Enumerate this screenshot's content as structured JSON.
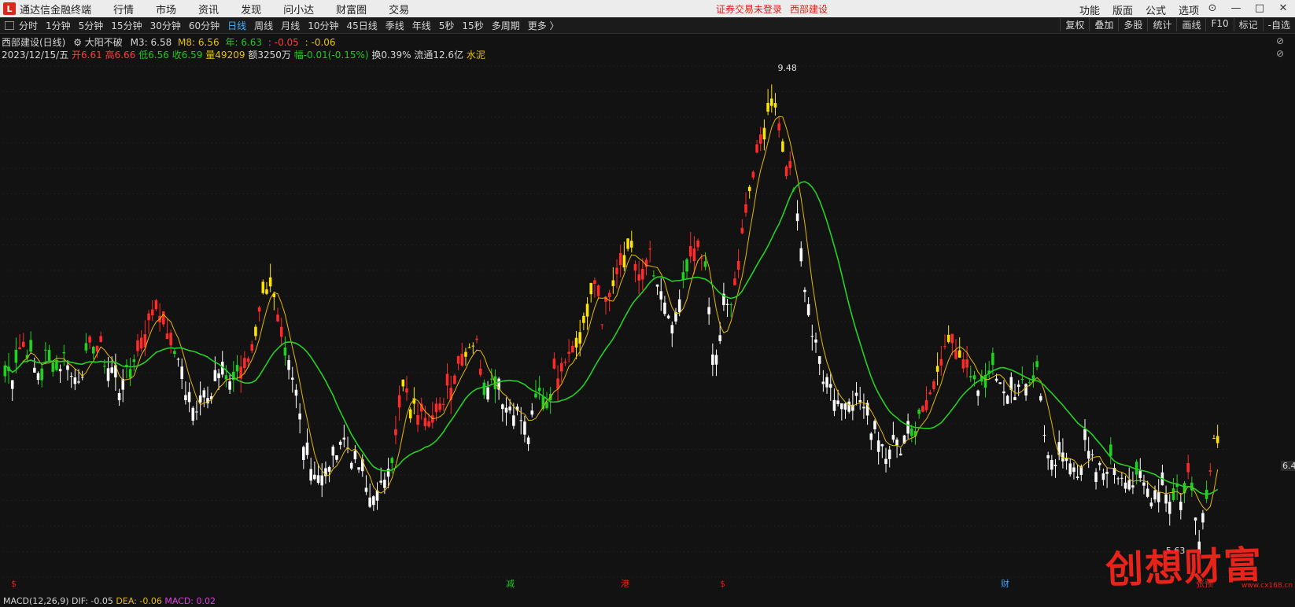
{
  "app": {
    "name": "通达信金融终端",
    "logo_glyph": "L",
    "menu": [
      "行情",
      "市场",
      "资讯",
      "发现",
      "问小达",
      "财富圈",
      "交易"
    ],
    "notice": "证券交易未登录",
    "stock_name": "西部建设",
    "right_menu": [
      "功能",
      "版面",
      "公式",
      "选项"
    ]
  },
  "toolbar": {
    "periods": [
      "分时",
      "1分钟",
      "5分钟",
      "15分钟",
      "30分钟",
      "60分钟",
      "日线",
      "周线",
      "月线",
      "10分钟",
      "45日线",
      "季线",
      "年线",
      "5秒",
      "15秒",
      "多周期",
      "更多 〉"
    ],
    "active_period": "日线",
    "right_tools": [
      "复权",
      "叠加",
      "多股",
      "统计",
      "画线",
      "F10",
      "标记",
      "-自选"
    ]
  },
  "info": {
    "title": "西部建设(日线)",
    "indicator_name": "大阳不破",
    "m3_label": "M3:",
    "m3": "6.58",
    "m8_label": "M8:",
    "m8": "6.56",
    "year_label": "年:",
    "year": "6.63",
    "sep1": ":",
    "v1": "-0.05",
    "sep2": ":",
    "v2": "-0.06",
    "date": "2023/12/15/五",
    "open": "开6.61",
    "high": "高6.66",
    "low": "低6.56",
    "close": "收6.59",
    "volume": "量49209",
    "amount": "额3250万",
    "change": "幅-0.01(-0.15%)",
    "turnover": "换0.39%",
    "float": "流通12.6亿",
    "sector": "水泥",
    "corner1": "⊘",
    "corner2": "⊘"
  },
  "chart_data": {
    "type": "candlestick",
    "max_label": "9.48",
    "min_label": "5.63",
    "last_price_label": "6.4",
    "ylim": [
      5.5,
      9.6
    ],
    "series_colors": {
      "up": "#ff2a2a",
      "down": "#ffffff",
      "strong": "#ffe400",
      "green_phase": "#1fd31f",
      "ma_short": "#e6b800",
      "ma_long": "#25d025"
    },
    "closes": [
      7.1,
      7.0,
      7.2,
      7.3,
      7.2,
      7.0,
      7.1,
      7.2,
      7.2,
      7.1,
      7.2,
      7.0,
      7.0,
      7.1,
      7.2,
      7.3,
      7.2,
      7.1,
      7.0,
      6.9,
      7.0,
      7.1,
      7.3,
      7.4,
      7.5,
      7.6,
      7.5,
      7.4,
      7.2,
      7.2,
      6.8,
      6.7,
      6.8,
      6.9,
      6.9,
      7.0,
      7.0,
      6.9,
      7.0,
      7.1,
      7.1,
      7.3,
      7.6,
      7.8,
      7.8,
      7.5,
      7.3,
      7.0,
      6.9,
      6.6,
      6.4,
      6.2,
      6.2,
      6.1,
      6.3,
      6.4,
      6.5,
      6.4,
      6.3,
      6.2,
      6.0,
      6.0,
      6.0,
      6.2,
      6.3,
      6.6,
      6.9,
      6.8,
      6.7,
      6.8,
      6.7,
      6.6,
      6.7,
      6.9,
      7.0,
      7.1,
      7.2,
      7.3,
      7.3,
      7.1,
      6.9,
      7.0,
      6.9,
      6.7,
      6.8,
      6.7,
      6.6,
      6.5,
      6.8,
      6.9,
      6.8,
      7.0,
      7.1,
      7.2,
      7.3,
      7.2,
      7.5,
      7.7,
      7.8,
      7.5,
      7.6,
      7.8,
      7.9,
      8.1,
      8.0,
      7.8,
      7.9,
      8.0,
      7.7,
      7.6,
      7.5,
      7.4,
      7.7,
      7.9,
      8.0,
      8.1,
      7.9,
      7.3,
      7.2,
      7.5,
      7.6,
      7.8,
      8.2,
      8.5,
      8.8,
      8.9,
      9.1,
      9.4,
      9.2,
      8.9,
      8.7,
      8.5,
      8.0,
      7.6,
      7.3,
      7.1,
      7.0,
      6.9,
      6.8,
      6.7,
      6.9,
      6.8,
      6.8,
      6.6,
      6.6,
      6.5,
      6.4,
      6.5,
      6.4,
      6.5,
      6.6,
      6.6,
      6.7,
      6.8,
      6.9,
      7.1,
      7.2,
      7.3,
      7.3,
      7.2,
      7.0,
      6.9,
      7.0,
      7.1,
      7.0,
      6.9,
      6.8,
      6.9,
      6.9,
      6.9,
      7.0,
      7.1,
      6.7,
      6.3,
      6.2,
      6.4,
      6.3,
      6.3,
      6.2,
      6.4,
      6.3,
      6.2,
      6.2,
      6.3,
      6.2,
      6.2,
      6.2,
      6.1,
      6.1,
      6.1,
      6.0,
      6.1,
      6.1,
      6.0,
      6.1,
      6.0,
      6.2,
      6.0,
      5.7,
      6.0,
      6.4,
      6.58
    ],
    "annotations": [
      "$",
      "减",
      "港",
      "$",
      "财",
      "张预"
    ]
  },
  "bottom": {
    "macd_name": "MACD(12,26,9)",
    "dif": "DIF: -0.05",
    "dea": "DEA: -0.06",
    "macd": "MACD: 0.02"
  },
  "watermark": {
    "text": "创想财富",
    "url": "www.cx168.cn"
  }
}
